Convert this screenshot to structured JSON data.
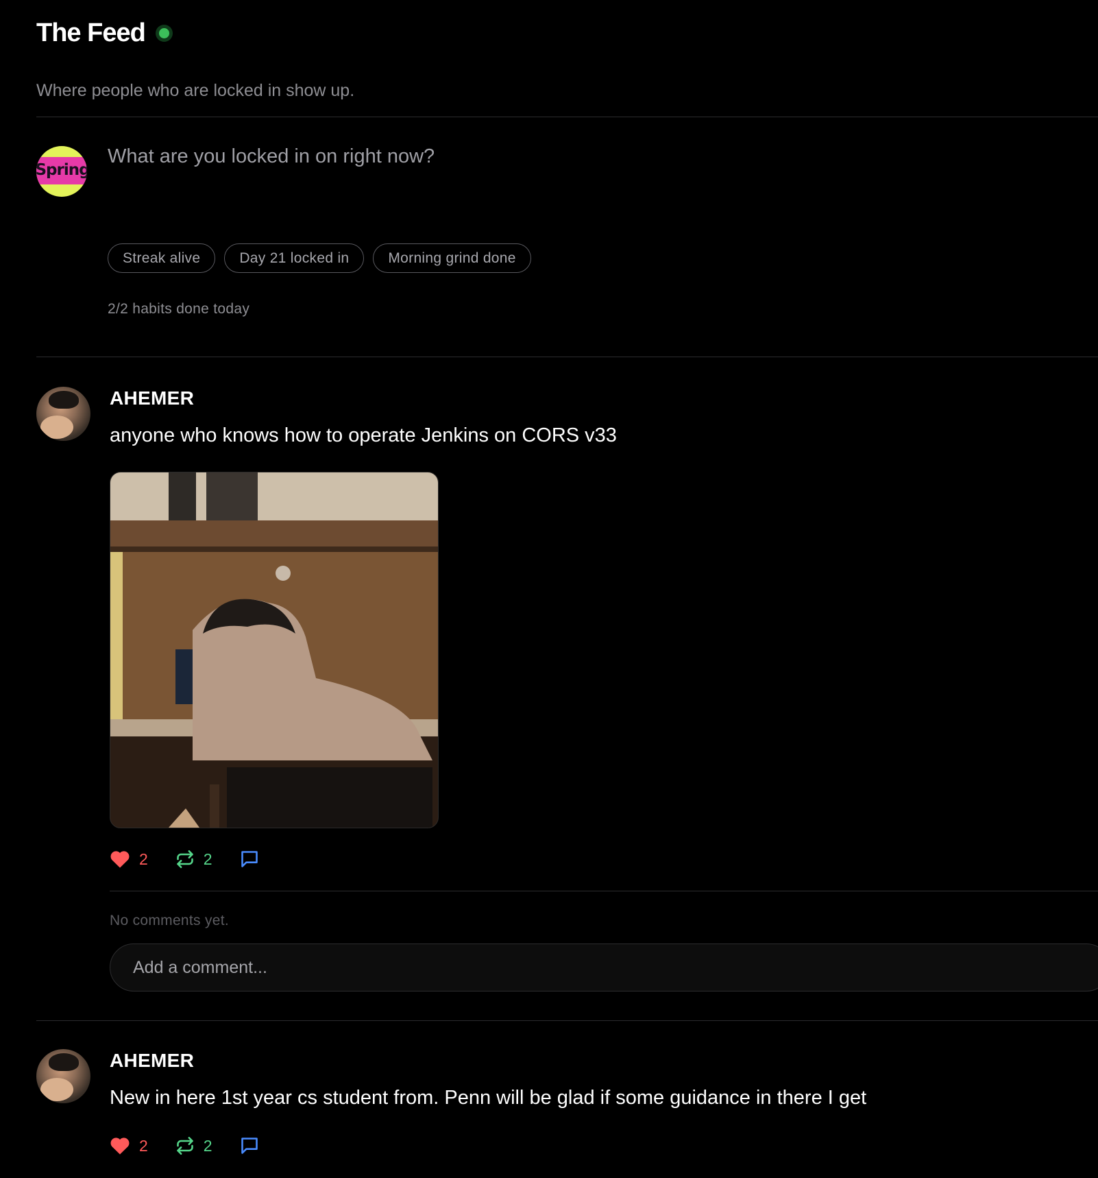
{
  "header": {
    "title": "The Feed",
    "subtitle": "Where people who are locked in show up."
  },
  "composer": {
    "placeholder": "What are you locked in on right now?",
    "avatar_text": "Spring",
    "chips": [
      "Streak alive",
      "Day 21 locked in",
      "Morning grind done"
    ],
    "habits_status": "2/2 habits done today"
  },
  "posts": [
    {
      "username": "AHEMER",
      "text": "anyone who knows how to operate Jenkins on CORS v33",
      "has_image": true,
      "likes": "2",
      "reposts": "2",
      "no_comments_text": "No comments yet.",
      "comment_placeholder": "Add a comment..."
    },
    {
      "username": "AHEMER",
      "text": "New in here 1st year cs student from. Penn will be glad if some guidance in there I get",
      "has_image": false,
      "likes": "2",
      "reposts": "2"
    }
  ],
  "colors": {
    "live_dot": "#3cbf5a",
    "like": "#ff5a5a",
    "repost": "#55d68a",
    "comment": "#4a8cff"
  },
  "icons": {
    "like": "heart-icon",
    "repost": "repost-icon",
    "comment": "comment-icon"
  }
}
